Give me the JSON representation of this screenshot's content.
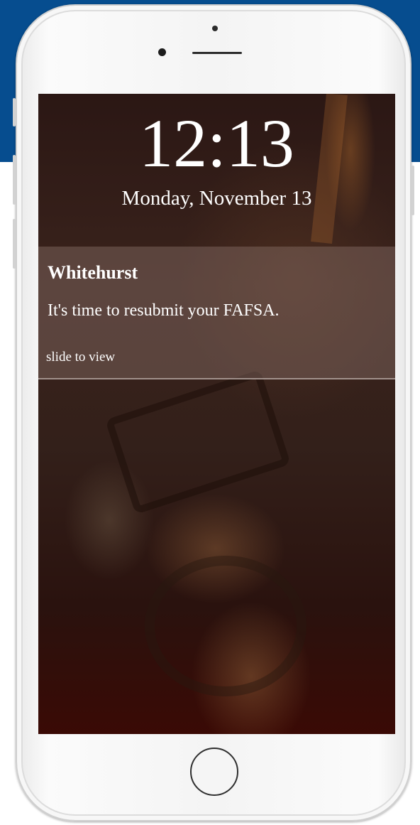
{
  "lock_screen": {
    "time": "12:13",
    "date": "Monday, November 13"
  },
  "notification": {
    "app_name": "Whitehurst",
    "message": "It's time to resubmit your FAFSA.",
    "action": "slide to view"
  },
  "colors": {
    "background_band": "#064d8f",
    "phone_body": "#f4f4f4",
    "text": "#ffffff"
  },
  "icons": {
    "home_button": "home-button-ring",
    "camera": "front-camera-dot",
    "speaker": "earpiece-slot"
  }
}
